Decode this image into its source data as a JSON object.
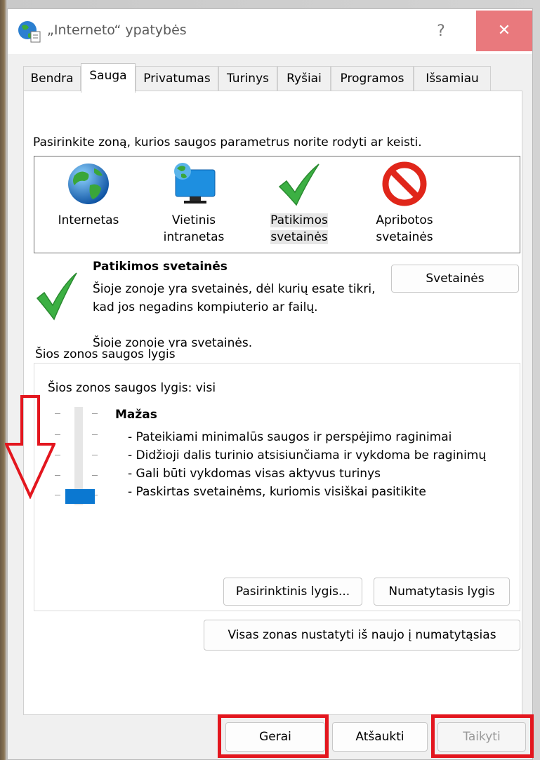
{
  "window": {
    "title": "„Interneto“ ypatybės",
    "help_label": "?",
    "close_label": "✕",
    "close_color": "#e9797d"
  },
  "tabs": [
    {
      "label": "Bendra",
      "active": false
    },
    {
      "label": "Sauga",
      "active": true
    },
    {
      "label": "Privatumas",
      "active": false
    },
    {
      "label": "Turinys",
      "active": false
    },
    {
      "label": "Ryšiai",
      "active": false
    },
    {
      "label": "Programos",
      "active": false
    },
    {
      "label": "Išsamiau",
      "active": false
    }
  ],
  "security": {
    "instruction": "Pasirinkite zoną, kurios saugos parametrus norite rodyti ar keisti.",
    "zones": [
      {
        "line1": "Internetas",
        "line2": "",
        "icon": "globe-icon",
        "selected": false
      },
      {
        "line1": "Vietinis",
        "line2": "intranetas",
        "icon": "intranet-monitor-icon",
        "selected": false
      },
      {
        "line1": "Patikimos",
        "line2": "svetainės",
        "icon": "green-check-icon",
        "selected": true
      },
      {
        "line1": "Apribotos",
        "line2": "svetainės",
        "icon": "prohibited-icon",
        "selected": false
      }
    ],
    "selected_zone_name": "Patikimos svetainės",
    "selected_zone_desc": "Šioje zonoje yra svetainės, dėl kurių esate tikri, kad jos negadins kompiuterio ar failų.",
    "selected_zone_desc2": "Šioje zonoje yra svetainės.",
    "sites_button": "Svetainės"
  },
  "level_group": {
    "legend": "Šios zonos saugos lygis",
    "status": "Šios zonos saugos lygis: visi",
    "level_title": "Mažas",
    "level_lines": [
      "- Pateikiami minimalūs saugos ir perspėjimo raginimai",
      "- Didžioji dalis turinio atsisiunčiama ir vykdoma be raginimų",
      "- Gali būti vykdomas visas aktyvus turinys",
      "- Paskirtas svetainėms, kuriomis visiškai pasitikite"
    ],
    "slider_level": "Mažas",
    "custom_button": "Pasirinktinis lygis...",
    "default_button": "Numatytasis lygis"
  },
  "reset_all_button": "Visas zonas nustatyti iš naujo į numatytąsias",
  "footer": {
    "ok": "Gerai",
    "cancel": "Atšaukti",
    "apply": "Taikyti"
  },
  "annotation_color": "#e3161e",
  "accent_color": "#0b78d1"
}
